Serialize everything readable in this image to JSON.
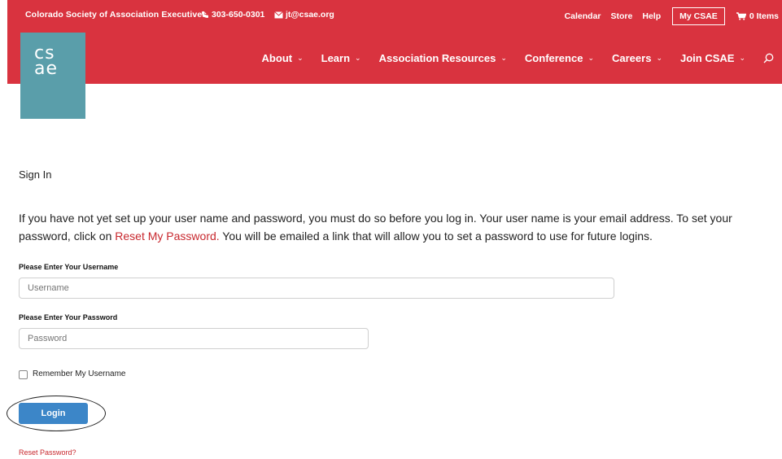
{
  "topbar": {
    "org": "Colorado Society of Association Executives",
    "phone": "303-650-0301",
    "email": "jt@csae.org",
    "links": [
      "Calendar",
      "Store",
      "Help"
    ],
    "my_csae": "My CSAE",
    "cart": "0 Items"
  },
  "logo": {
    "line1": "cs",
    "line2": "ae"
  },
  "nav": [
    {
      "label": "About"
    },
    {
      "label": "Learn"
    },
    {
      "label": "Association Resources"
    },
    {
      "label": "Conference"
    },
    {
      "label": "Careers"
    },
    {
      "label": "Join CSAE"
    }
  ],
  "colors": {
    "brand_red": "#d9333f",
    "logo_teal": "#5a9eaa",
    "button_blue": "#3c86c8",
    "link_red": "#c8282e"
  },
  "icons": {
    "phone": "phone-icon",
    "email": "envelope-icon",
    "cart": "cart-icon",
    "search": "search-icon",
    "chevron": "chevron-down-icon"
  },
  "page": {
    "title": "Sign In",
    "intro_pre": "If you have not yet set up your user name and password, you must do so before you log in. Your user name is your email address. To set your password, click on ",
    "intro_link": "Reset My Password.",
    "intro_post": " You will be emailed a link that will allow you to set a password to use for future logins."
  },
  "form": {
    "username_label": "Please Enter Your Username",
    "username_placeholder": "Username",
    "password_label": "Please Enter Your Password",
    "password_placeholder": "Password",
    "remember_label": "Remember My Username",
    "login_label": "Login",
    "reset_link": "Reset Password?"
  }
}
